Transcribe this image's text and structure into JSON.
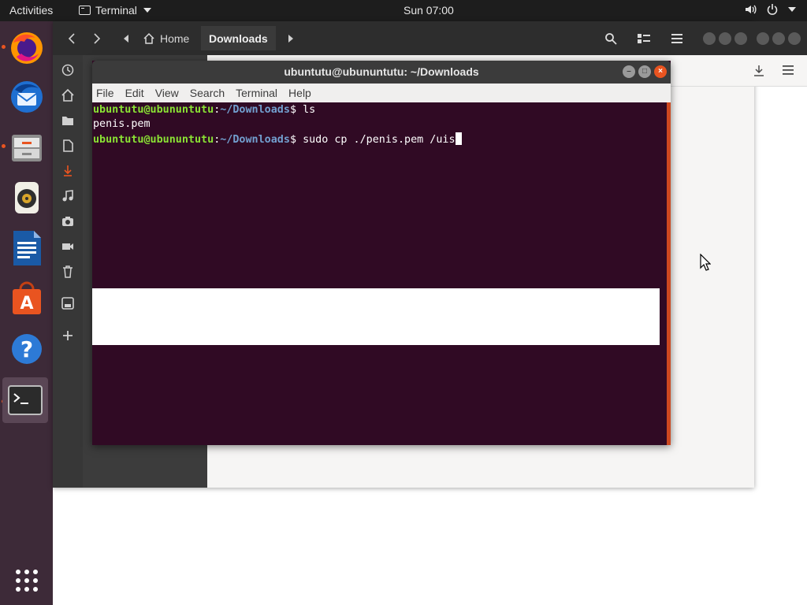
{
  "topbar": {
    "activities": "Activities",
    "app_menu": "Terminal",
    "clock": "Sun 07:00"
  },
  "dock": {
    "items": [
      "Firefox",
      "Thunderbird",
      "Files",
      "Rhythmbox",
      "LibreOffice Writer",
      "Ubuntu Software",
      "Help",
      "Terminal"
    ]
  },
  "file_manager": {
    "breadcrumb": {
      "home": "Home",
      "current": "Downloads"
    }
  },
  "terminal": {
    "title": "ubuntutu@ubununtutu: ~/Downloads",
    "menu": [
      "File",
      "Edit",
      "View",
      "Search",
      "Terminal",
      "Help"
    ],
    "lines": [
      {
        "user": "ubuntutu@ubununtutu",
        "sep": ":",
        "path": "~/Downloads",
        "prompt": "$ ",
        "cmd": "ls"
      },
      {
        "output": "penis.pem"
      },
      {
        "user": "ubuntutu@ubununtutu",
        "sep": ":",
        "path": "~/Downloads",
        "prompt": "$ ",
        "cmd": "sudo cp ./penis.pem /uis"
      }
    ]
  },
  "colors": {
    "terminal_bg": "#300a24",
    "prompt_user": "#8ae234",
    "prompt_path": "#729fcf",
    "accent": "#e95420",
    "dock_bg": "#3d2a38",
    "topbar_bg": "#1d1d1d"
  }
}
